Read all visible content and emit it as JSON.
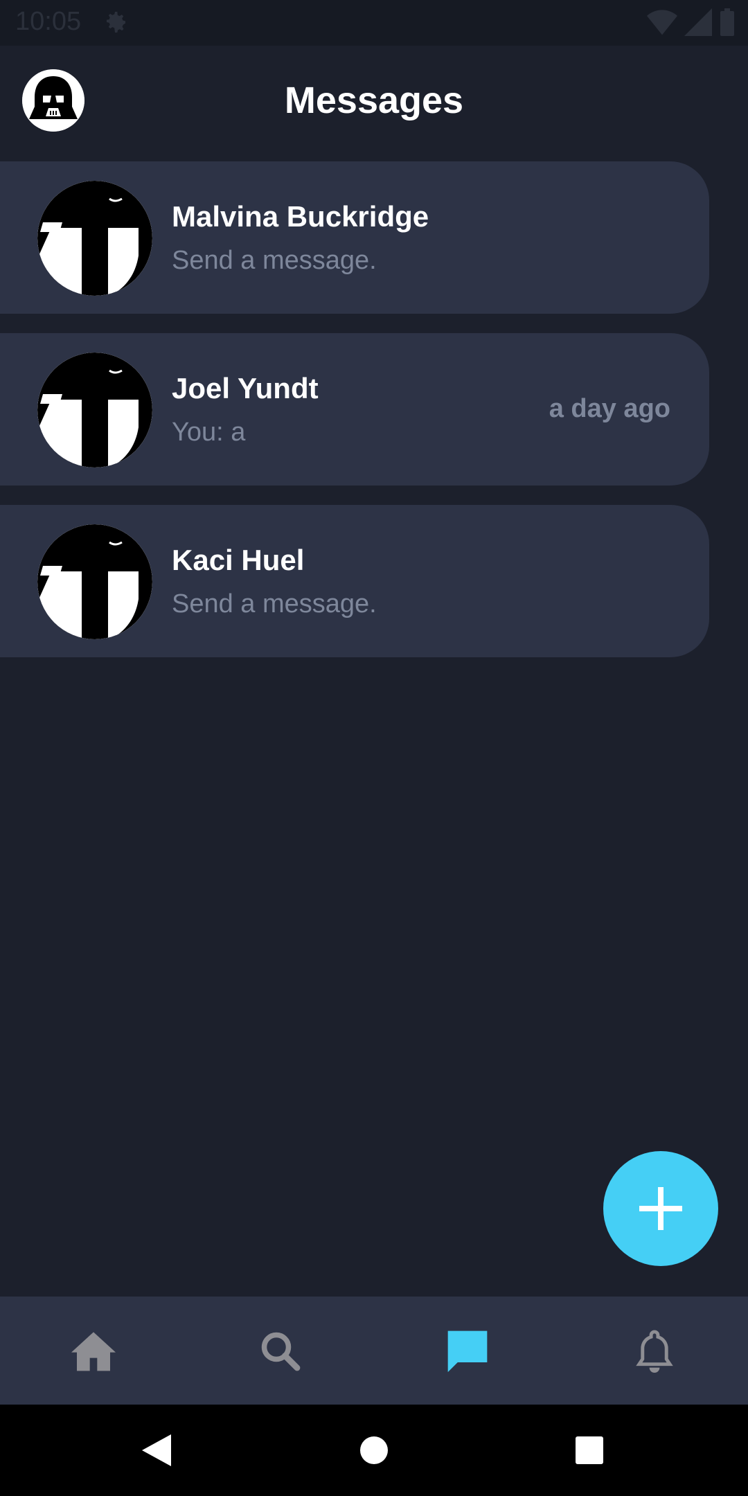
{
  "status_bar": {
    "time": "10:05",
    "icons": [
      "gear-icon",
      "wifi-icon",
      "cell-signal-icon",
      "battery-icon"
    ]
  },
  "header": {
    "title": "Messages",
    "avatar_icon": "darth-vader-avatar"
  },
  "conversations": [
    {
      "name": "Malvina Buckridge",
      "preview": "Send a message.",
      "time": "",
      "avatar_icon": "mandalorian-helmet-avatar"
    },
    {
      "name": "Joel Yundt",
      "preview": "You: a",
      "time": "a day ago",
      "avatar_icon": "mandalorian-helmet-avatar"
    },
    {
      "name": "Kaci Huel",
      "preview": "Send a message.",
      "time": "",
      "avatar_icon": "mandalorian-helmet-avatar"
    }
  ],
  "fab": {
    "icon": "plus-icon"
  },
  "bottom_nav": {
    "items": [
      {
        "icon": "home-icon",
        "active": false
      },
      {
        "icon": "search-icon",
        "active": false
      },
      {
        "icon": "chat-icon",
        "active": true
      },
      {
        "icon": "bell-icon",
        "active": false
      }
    ]
  },
  "system_nav": {
    "icons": [
      "back-icon",
      "home-circle-icon",
      "recents-icon"
    ]
  },
  "colors": {
    "background": "#1c202c",
    "card": "#2d3346",
    "accent": "#45cff5",
    "muted_text": "#7e879b",
    "nav_inactive": "#8e8e93"
  }
}
